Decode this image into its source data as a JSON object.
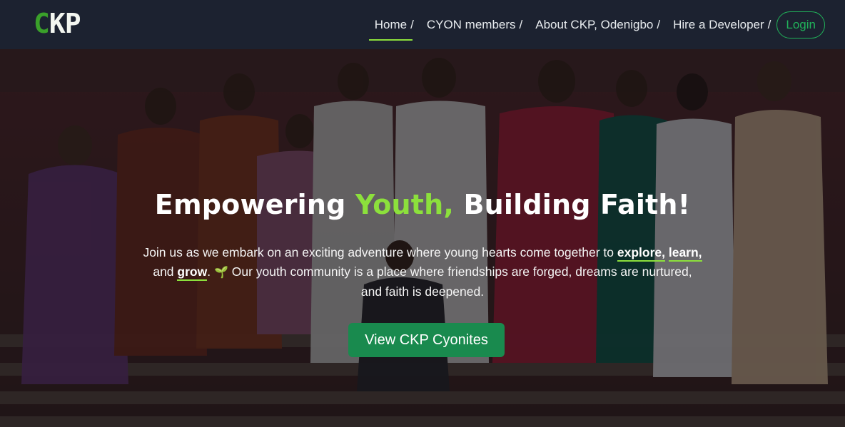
{
  "brand": {
    "logo_c": "C",
    "logo_kp": "KP"
  },
  "nav": {
    "items": [
      {
        "label": "Home",
        "sep": "/"
      },
      {
        "label": "CYON members",
        "sep": "/"
      },
      {
        "label": "About CKP, Odenigbo",
        "sep": "/"
      },
      {
        "label": "Hire a Developer",
        "sep": "/"
      }
    ],
    "login": "Login"
  },
  "hero": {
    "headline_pre": "Empowering ",
    "headline_highlight": "Youth,",
    "headline_post": " Building Faith!",
    "lead_1": "Join us as we embark on an exciting adventure where young hearts come together to ",
    "kw_1": "explore,",
    "kw_2": "learn,",
    "lead_and": " and ",
    "kw_3": "grow",
    "lead_dot": ". ",
    "sprout": "🌱",
    "lead_2": " Our youth community is a place where friendships are forged, dreams are nurtured, and faith is deepened.",
    "cta": "View CKP Cyonites"
  },
  "colors": {
    "nav_bg": "#1c2230",
    "accent_green": "#8ce03c",
    "button_green": "#198a4e",
    "login_green": "#21b35a"
  }
}
